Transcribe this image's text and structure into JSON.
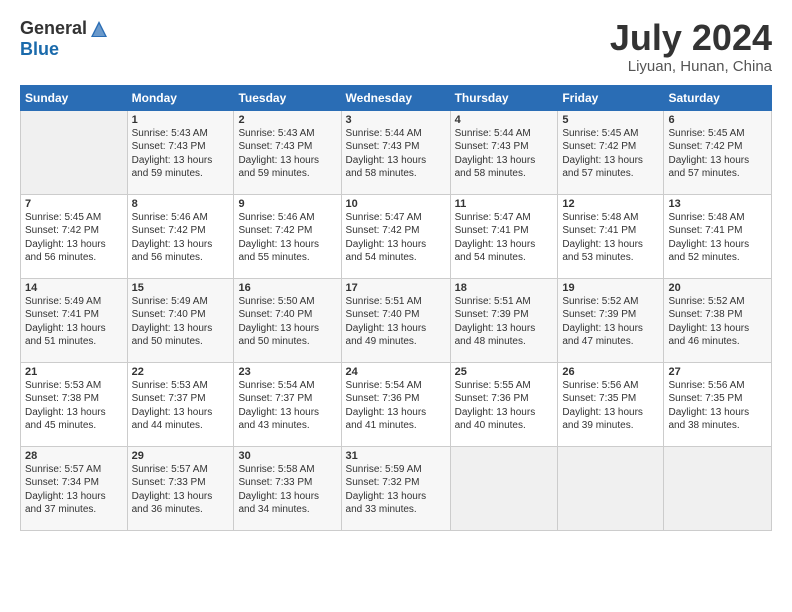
{
  "logo": {
    "general": "General",
    "blue": "Blue"
  },
  "title": "July 2024",
  "location": "Liyuan, Hunan, China",
  "days_of_week": [
    "Sunday",
    "Monday",
    "Tuesday",
    "Wednesday",
    "Thursday",
    "Friday",
    "Saturday"
  ],
  "weeks": [
    [
      {
        "day": "",
        "info": ""
      },
      {
        "day": "1",
        "info": "Sunrise: 5:43 AM\nSunset: 7:43 PM\nDaylight: 13 hours\nand 59 minutes."
      },
      {
        "day": "2",
        "info": "Sunrise: 5:43 AM\nSunset: 7:43 PM\nDaylight: 13 hours\nand 59 minutes."
      },
      {
        "day": "3",
        "info": "Sunrise: 5:44 AM\nSunset: 7:43 PM\nDaylight: 13 hours\nand 58 minutes."
      },
      {
        "day": "4",
        "info": "Sunrise: 5:44 AM\nSunset: 7:43 PM\nDaylight: 13 hours\nand 58 minutes."
      },
      {
        "day": "5",
        "info": "Sunrise: 5:45 AM\nSunset: 7:42 PM\nDaylight: 13 hours\nand 57 minutes."
      },
      {
        "day": "6",
        "info": "Sunrise: 5:45 AM\nSunset: 7:42 PM\nDaylight: 13 hours\nand 57 minutes."
      }
    ],
    [
      {
        "day": "7",
        "info": "Sunrise: 5:45 AM\nSunset: 7:42 PM\nDaylight: 13 hours\nand 56 minutes."
      },
      {
        "day": "8",
        "info": "Sunrise: 5:46 AM\nSunset: 7:42 PM\nDaylight: 13 hours\nand 56 minutes."
      },
      {
        "day": "9",
        "info": "Sunrise: 5:46 AM\nSunset: 7:42 PM\nDaylight: 13 hours\nand 55 minutes."
      },
      {
        "day": "10",
        "info": "Sunrise: 5:47 AM\nSunset: 7:42 PM\nDaylight: 13 hours\nand 54 minutes."
      },
      {
        "day": "11",
        "info": "Sunrise: 5:47 AM\nSunset: 7:41 PM\nDaylight: 13 hours\nand 54 minutes."
      },
      {
        "day": "12",
        "info": "Sunrise: 5:48 AM\nSunset: 7:41 PM\nDaylight: 13 hours\nand 53 minutes."
      },
      {
        "day": "13",
        "info": "Sunrise: 5:48 AM\nSunset: 7:41 PM\nDaylight: 13 hours\nand 52 minutes."
      }
    ],
    [
      {
        "day": "14",
        "info": "Sunrise: 5:49 AM\nSunset: 7:41 PM\nDaylight: 13 hours\nand 51 minutes."
      },
      {
        "day": "15",
        "info": "Sunrise: 5:49 AM\nSunset: 7:40 PM\nDaylight: 13 hours\nand 50 minutes."
      },
      {
        "day": "16",
        "info": "Sunrise: 5:50 AM\nSunset: 7:40 PM\nDaylight: 13 hours\nand 50 minutes."
      },
      {
        "day": "17",
        "info": "Sunrise: 5:51 AM\nSunset: 7:40 PM\nDaylight: 13 hours\nand 49 minutes."
      },
      {
        "day": "18",
        "info": "Sunrise: 5:51 AM\nSunset: 7:39 PM\nDaylight: 13 hours\nand 48 minutes."
      },
      {
        "day": "19",
        "info": "Sunrise: 5:52 AM\nSunset: 7:39 PM\nDaylight: 13 hours\nand 47 minutes."
      },
      {
        "day": "20",
        "info": "Sunrise: 5:52 AM\nSunset: 7:38 PM\nDaylight: 13 hours\nand 46 minutes."
      }
    ],
    [
      {
        "day": "21",
        "info": "Sunrise: 5:53 AM\nSunset: 7:38 PM\nDaylight: 13 hours\nand 45 minutes."
      },
      {
        "day": "22",
        "info": "Sunrise: 5:53 AM\nSunset: 7:37 PM\nDaylight: 13 hours\nand 44 minutes."
      },
      {
        "day": "23",
        "info": "Sunrise: 5:54 AM\nSunset: 7:37 PM\nDaylight: 13 hours\nand 43 minutes."
      },
      {
        "day": "24",
        "info": "Sunrise: 5:54 AM\nSunset: 7:36 PM\nDaylight: 13 hours\nand 41 minutes."
      },
      {
        "day": "25",
        "info": "Sunrise: 5:55 AM\nSunset: 7:36 PM\nDaylight: 13 hours\nand 40 minutes."
      },
      {
        "day": "26",
        "info": "Sunrise: 5:56 AM\nSunset: 7:35 PM\nDaylight: 13 hours\nand 39 minutes."
      },
      {
        "day": "27",
        "info": "Sunrise: 5:56 AM\nSunset: 7:35 PM\nDaylight: 13 hours\nand 38 minutes."
      }
    ],
    [
      {
        "day": "28",
        "info": "Sunrise: 5:57 AM\nSunset: 7:34 PM\nDaylight: 13 hours\nand 37 minutes."
      },
      {
        "day": "29",
        "info": "Sunrise: 5:57 AM\nSunset: 7:33 PM\nDaylight: 13 hours\nand 36 minutes."
      },
      {
        "day": "30",
        "info": "Sunrise: 5:58 AM\nSunset: 7:33 PM\nDaylight: 13 hours\nand 34 minutes."
      },
      {
        "day": "31",
        "info": "Sunrise: 5:59 AM\nSunset: 7:32 PM\nDaylight: 13 hours\nand 33 minutes."
      },
      {
        "day": "",
        "info": ""
      },
      {
        "day": "",
        "info": ""
      },
      {
        "day": "",
        "info": ""
      }
    ]
  ]
}
